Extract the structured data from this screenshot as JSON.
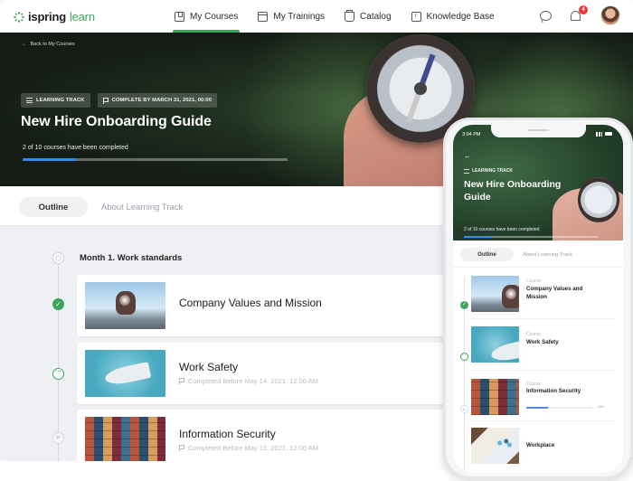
{
  "app": {
    "logo_brand": "ispring",
    "logo_product": "learn"
  },
  "nav": {
    "items": [
      {
        "label": "My Courses",
        "icon": "book-icon",
        "active": true
      },
      {
        "label": "My Trainings",
        "icon": "calendar-icon",
        "active": false
      },
      {
        "label": "Catalog",
        "icon": "catalog-icon",
        "active": false
      },
      {
        "label": "Knowledge Base",
        "icon": "knowledge-base-icon",
        "active": false
      }
    ],
    "notifications_count": "4"
  },
  "hero": {
    "back_label": "Back to My Courses",
    "chip_type": "LEARNING TRACK",
    "chip_due": "COMPLETE BY MARCH 31, 2021, 00:00",
    "title": "New Hire Onboarding Guide",
    "progress_text": "2 of 10 courses have been completed",
    "progress_completed": 2,
    "progress_total": 10
  },
  "tabs": {
    "outline": "Outline",
    "about": "About Learning Track"
  },
  "outline": {
    "section_title": "Month 1. Work standards",
    "courses": [
      {
        "title": "Company Values and Mission",
        "status": "completed",
        "meta": ""
      },
      {
        "title": "Work Safety",
        "status": "in-progress",
        "meta": "Completed Before May 14, 2021, 12:00 AM"
      },
      {
        "title": "Information Security",
        "status": "not-started",
        "meta": "Completed Before May 15, 2021, 12:00 AM"
      }
    ]
  },
  "phone": {
    "time": "3:04 PM",
    "back_arrow": "←",
    "chip_type": "LEARNING TRACK",
    "title": "New Hire Onboarding Guide",
    "progress_text": "2 of 10 courses have been completed",
    "tab_outline": "Outline",
    "tab_about": "About Learning Track",
    "items": [
      {
        "label": "Course",
        "name": "Company Values and Mission"
      },
      {
        "label": "Course",
        "name": "Work Safety"
      },
      {
        "label": "Course",
        "name": "Information Security",
        "progress_percent": 33,
        "progress_label": "33%"
      },
      {
        "label": "",
        "name": "Workplace"
      }
    ]
  },
  "colors": {
    "accent": "#3ba55c",
    "progress": "#2f8cf0",
    "badge": "#e53935"
  }
}
